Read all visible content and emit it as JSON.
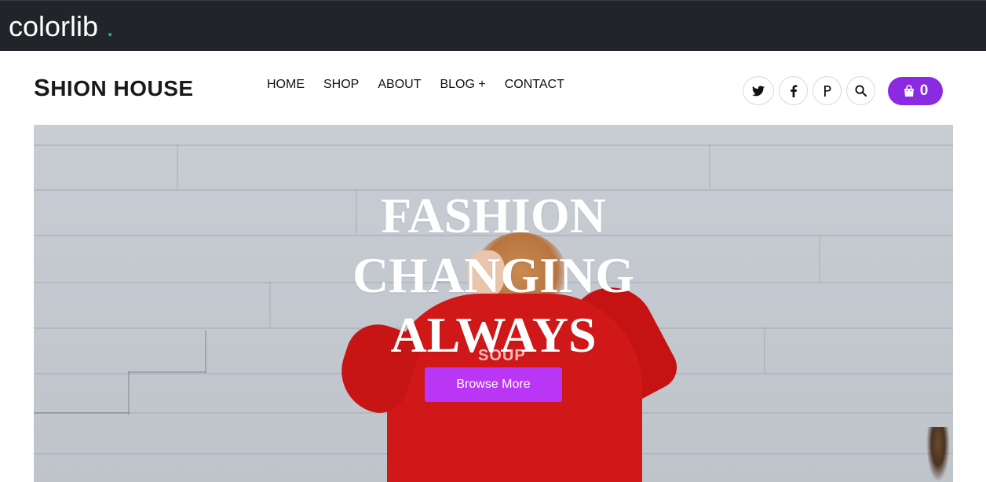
{
  "topbar": {
    "brand_text": "colorlib",
    "brand_dot": "."
  },
  "header": {
    "logo_first": "S",
    "logo_rest": "HION HOUSE",
    "nav": [
      "HOME",
      "SHOP",
      "ABOUT",
      "BLOG +",
      "CONTACT"
    ],
    "social_icons": [
      "twitter-icon",
      "facebook-icon",
      "pinterest-icon",
      "search-icon"
    ],
    "cart_count": "0"
  },
  "hero": {
    "title_lines": [
      "FASHION",
      "CHANGING",
      "ALWAYS"
    ],
    "shirt_text": "SOUP",
    "button_label": "Browse More"
  },
  "colors": {
    "topbar_bg": "#212529",
    "brand_dot": "#17b978",
    "cart_bg": "#8a2be2",
    "hero_button": "#b936f5"
  }
}
